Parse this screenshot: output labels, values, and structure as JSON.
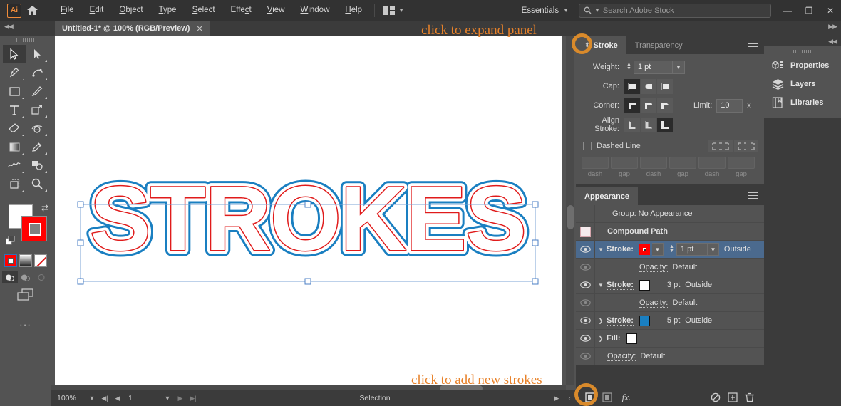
{
  "app": {
    "logo": "Ai",
    "title": "Untitled-1* @ 100% (RGB/Preview)"
  },
  "menubar": {
    "items": [
      "File",
      "Edit",
      "Object",
      "Type",
      "Select",
      "Effect",
      "View",
      "Window",
      "Help"
    ],
    "workspace": "Essentials",
    "search_placeholder": "Search Adobe Stock",
    "window_buttons": [
      "minimize",
      "maximize",
      "close"
    ]
  },
  "toolbar": {
    "tools": [
      "selection-tool",
      "direct-selection-tool",
      "pen-tool",
      "curvature-tool",
      "rectangle-tool",
      "paintbrush-tool",
      "type-tool",
      "free-transform-tool",
      "eraser-tool",
      "width-tool",
      "gradient-tool",
      "eyedropper-tool",
      "symbol-sprayer-tool",
      "shape-builder-tool",
      "artboard-tool",
      "zoom-tool"
    ],
    "fill_color": "#ffffff",
    "stroke_color": "#ff0000",
    "modes": [
      "color-mode",
      "gradient-mode",
      "none-mode"
    ],
    "draw_modes": [
      "draw-normal",
      "draw-behind",
      "draw-inside"
    ],
    "screen_mode": "change-screen-mode",
    "more_tools": "..."
  },
  "document": {
    "artwork_text": "STROKES",
    "stroke_outer_color": "#1a7fc1",
    "stroke_mid_color": "#ffffff",
    "stroke_inner_color": "#e01b1b",
    "selection_handle_color": "#6e9fd4"
  },
  "statusbar": {
    "zoom": "100%",
    "page": "1",
    "status": "Selection"
  },
  "stroke_panel": {
    "tabs": [
      {
        "label": "Stroke",
        "active": true
      },
      {
        "label": "Transparency",
        "active": false
      }
    ],
    "weight_label": "Weight:",
    "weight_value": "1 pt",
    "cap_label": "Cap:",
    "cap_options": [
      "butt-cap",
      "round-cap",
      "projecting-cap"
    ],
    "cap_selected": 0,
    "corner_label": "Corner:",
    "corner_options": [
      "miter-join",
      "round-join",
      "bevel-join"
    ],
    "corner_selected": 0,
    "limit_label": "Limit:",
    "limit_value": "10",
    "limit_unit": "x",
    "align_label": "Align Stroke:",
    "align_options": [
      "align-center",
      "align-inside",
      "align-outside"
    ],
    "align_selected": 2,
    "dashed_label": "Dashed Line",
    "dashed_checked": false,
    "dash_buttons": [
      "preserve-exact-dash",
      "align-dashes-corners"
    ],
    "dash_fields": [
      "dash",
      "gap",
      "dash",
      "gap",
      "dash",
      "gap"
    ],
    "dash_values": [
      "",
      "",
      "",
      "",
      "",
      ""
    ]
  },
  "appearance_panel": {
    "tab_label": "Appearance",
    "rows": [
      {
        "name": "group",
        "label": "Group: No Appearance",
        "eye": false,
        "type": "header"
      },
      {
        "name": "compound-path",
        "label": "Compound Path",
        "eye": false,
        "type": "object",
        "swatch": "#f6ebed"
      },
      {
        "name": "stroke-1",
        "label": "Stroke:",
        "eye": true,
        "type": "stroke",
        "highlight": true,
        "swatch": "#ff0000",
        "weight": "1 pt",
        "align": "Outside",
        "twist": "open"
      },
      {
        "name": "opacity-1",
        "label": "Opacity:",
        "value": "Default",
        "eye": true,
        "dim": true,
        "type": "opacity"
      },
      {
        "name": "stroke-2",
        "label": "Stroke:",
        "eye": true,
        "type": "stroke",
        "swatch": "#ffffff",
        "weight": "3 pt",
        "align": "Outside",
        "twist": "open"
      },
      {
        "name": "opacity-2",
        "label": "Opacity:",
        "value": "Default",
        "eye": true,
        "dim": true,
        "type": "opacity"
      },
      {
        "name": "stroke-3",
        "label": "Stroke:",
        "eye": true,
        "type": "stroke",
        "swatch": "#1a7fc1",
        "weight": "5 pt",
        "align": "Outside",
        "twist": "closed"
      },
      {
        "name": "fill-1",
        "label": "Fill:",
        "eye": true,
        "type": "fill",
        "swatch": "#ffffff",
        "twist": "closed"
      },
      {
        "name": "opacity-3",
        "label": "Opacity:",
        "value": "Default",
        "eye": true,
        "dim": true,
        "type": "opacity"
      }
    ],
    "footer_icons": [
      "add-new-stroke",
      "add-new-fill",
      "add-new-effect",
      "clear-appearance",
      "duplicate-item",
      "delete-item"
    ],
    "fx_label": "fx."
  },
  "icon_dock": {
    "items": [
      {
        "label": "Properties",
        "icon": "properties-icon"
      },
      {
        "label": "Layers",
        "icon": "layers-icon"
      },
      {
        "label": "Libraries",
        "icon": "libraries-icon"
      }
    ]
  },
  "annotations": [
    {
      "name": "expand-panel-annotation",
      "text": "click to expand panel"
    },
    {
      "name": "add-strokes-annotation",
      "text": "click to add new strokes"
    }
  ],
  "colors": {
    "annotation": "#e8822a",
    "highlight_row": "#4b6a8e",
    "panel_bg": "#535353",
    "dock_bg": "#3b3b3b",
    "menu_bg": "#323232"
  }
}
